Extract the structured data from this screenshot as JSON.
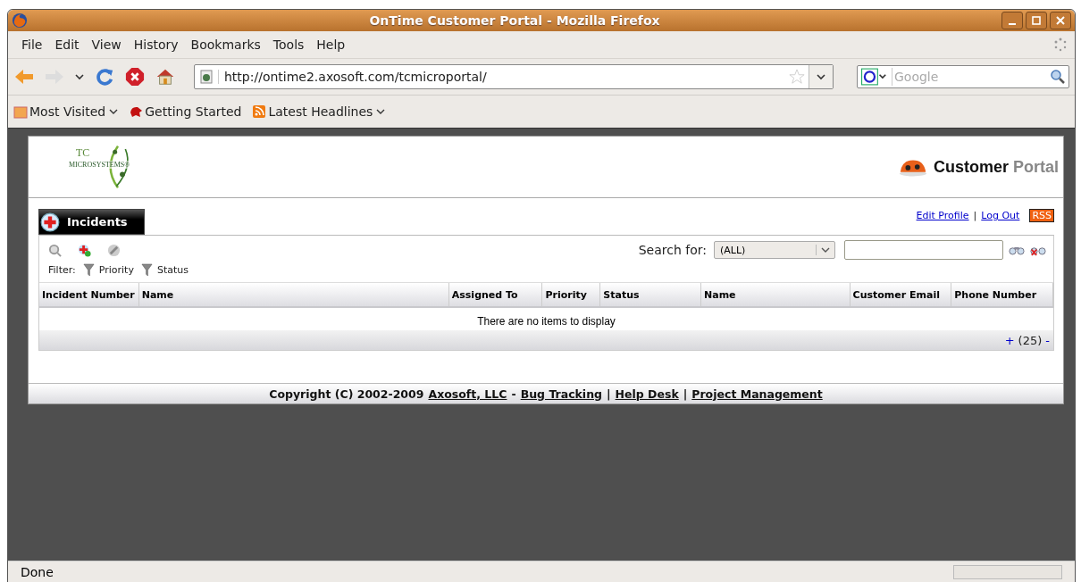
{
  "window": {
    "title": "OnTime Customer Portal - Mozilla Firefox"
  },
  "menu": [
    "File",
    "Edit",
    "View",
    "History",
    "Bookmarks",
    "Tools",
    "Help"
  ],
  "address_bar": {
    "value": "http://ontime2.axosoft.com/tcmicroportal/"
  },
  "search_bar": {
    "placeholder": "Google"
  },
  "bookmarks": [
    {
      "label": "Most Visited",
      "kind": "folder"
    },
    {
      "label": "Getting Started",
      "kind": "page"
    },
    {
      "label": "Latest Headlines",
      "kind": "feed"
    }
  ],
  "page": {
    "logo": {
      "initials": "TC",
      "name": "MICROSYSTEMS®"
    },
    "portal_title": {
      "first": "Customer",
      "second": "Portal"
    },
    "section_tab": "Incidents",
    "links": [
      "Edit Profile",
      "Log Out"
    ],
    "rss": "RSS",
    "filter": {
      "label": "Filter:",
      "items": [
        "Priority",
        "Status"
      ]
    },
    "search": {
      "label": "Search for:",
      "option": "(ALL)"
    },
    "links_separator": "|",
    "table": {
      "columns": [
        {
          "label": "Incident Number"
        },
        {
          "label": "Name"
        },
        {
          "label": "Assigned To"
        },
        {
          "label": "Priority"
        },
        {
          "label": "Status"
        },
        {
          "label": "Name"
        },
        {
          "label": "Customer Email"
        },
        {
          "label": "Phone Number"
        }
      ],
      "empty_message": "There are no items to display",
      "pager": {
        "plus": "+",
        "size": "(25)",
        "minus": "-"
      }
    },
    "footer": {
      "copyright": "Copyright (C) 2002-2009",
      "company": "Axosoft, LLC",
      "separator": "-",
      "links": [
        "Bug Tracking",
        "Help Desk",
        "Project Management"
      ],
      "divider": "|"
    }
  },
  "status_bar": {
    "text": "Done",
    "progress": {
      "level": 0
    }
  }
}
